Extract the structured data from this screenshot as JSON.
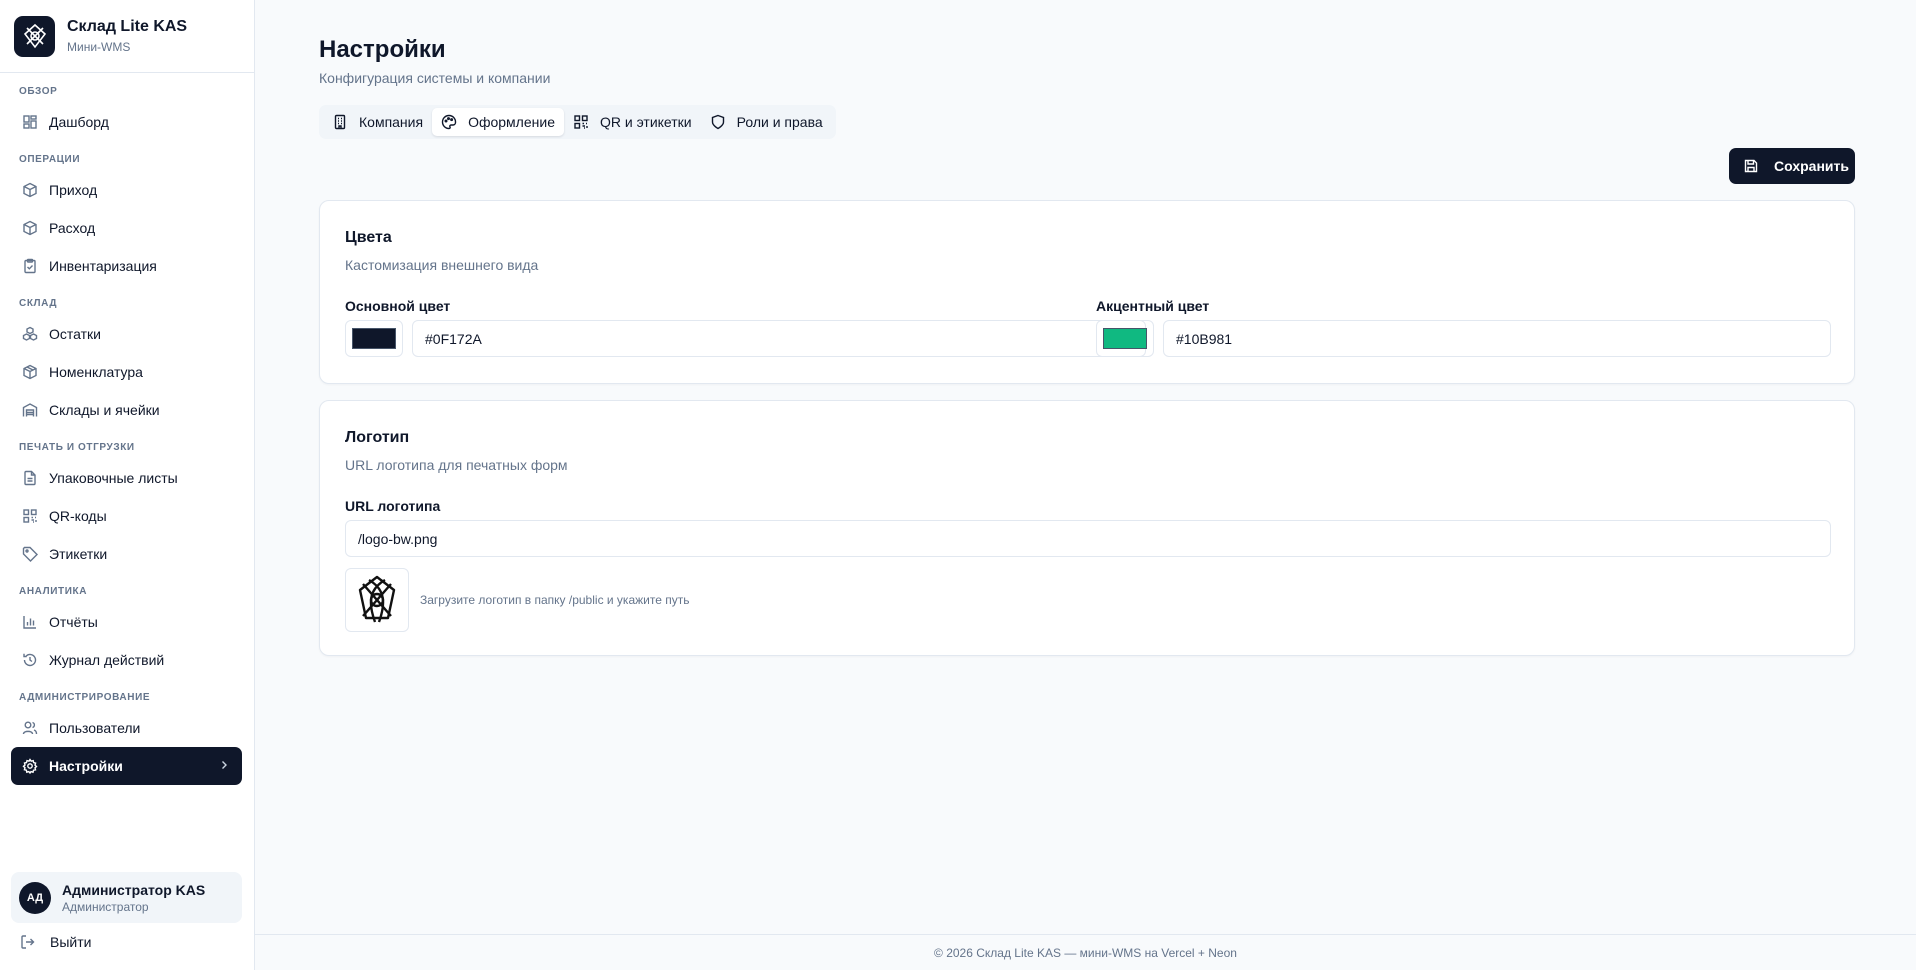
{
  "brand": {
    "title": "Склад Lite KAS",
    "subtitle": "Мини-WMS"
  },
  "sidebar": {
    "sections": [
      {
        "label": "ОБЗОР",
        "items": [
          {
            "label": "Дашборд",
            "icon": "dashboard-icon"
          }
        ]
      },
      {
        "label": "ОПЕРАЦИИ",
        "items": [
          {
            "label": "Приход",
            "icon": "box-in-icon"
          },
          {
            "label": "Расход",
            "icon": "box-out-icon"
          },
          {
            "label": "Инвентаризация",
            "icon": "clipboard-check-icon"
          }
        ]
      },
      {
        "label": "СКЛАД",
        "items": [
          {
            "label": "Остатки",
            "icon": "boxes-icon"
          },
          {
            "label": "Номенклатура",
            "icon": "package-icon"
          },
          {
            "label": "Склады и ячейки",
            "icon": "warehouse-icon"
          }
        ]
      },
      {
        "label": "ПЕЧАТЬ И ОТГРУЗКИ",
        "items": [
          {
            "label": "Упаковочные листы",
            "icon": "file-text-icon"
          },
          {
            "label": "QR-коды",
            "icon": "qr-icon"
          },
          {
            "label": "Этикетки",
            "icon": "tag-icon"
          }
        ]
      },
      {
        "label": "АНАЛИТИКА",
        "items": [
          {
            "label": "Отчёты",
            "icon": "bar-chart-icon"
          },
          {
            "label": "Журнал действий",
            "icon": "history-icon"
          }
        ]
      },
      {
        "label": "АДМИНИСТРИРОВАНИЕ",
        "items": [
          {
            "label": "Пользователи",
            "icon": "users-icon"
          },
          {
            "label": "Настройки",
            "icon": "gear-icon",
            "active": true
          }
        ]
      }
    ]
  },
  "user": {
    "initials": "АД",
    "name": "Администратор KAS",
    "role": "Администратор"
  },
  "logout_label": "Выйти",
  "page": {
    "title": "Настройки",
    "subtitle": "Конфигурация системы и компании"
  },
  "tabs": [
    {
      "label": "Компания",
      "icon": "building-icon"
    },
    {
      "label": "Оформление",
      "icon": "palette-icon",
      "active": true
    },
    {
      "label": "QR и этикетки",
      "icon": "qr-icon"
    },
    {
      "label": "Роли и права",
      "icon": "shield-icon"
    }
  ],
  "save_label": "Сохранить",
  "colors_card": {
    "title": "Цвета",
    "description": "Кастомизация внешнего вида",
    "primary": {
      "label": "Основной цвет",
      "value": "#0F172A"
    },
    "accent": {
      "label": "Акцентный цвет",
      "value": "#10B981"
    }
  },
  "logo_card": {
    "title": "Логотип",
    "description": "URL логотипа для печатных форм",
    "url_label": "URL логотипа",
    "url_value": "/logo-bw.png",
    "hint": "Загрузите логотип в папку /public и укажите путь"
  },
  "footer": "© 2026 Склад Lite KAS — мини-WMS на Vercel + Neon"
}
